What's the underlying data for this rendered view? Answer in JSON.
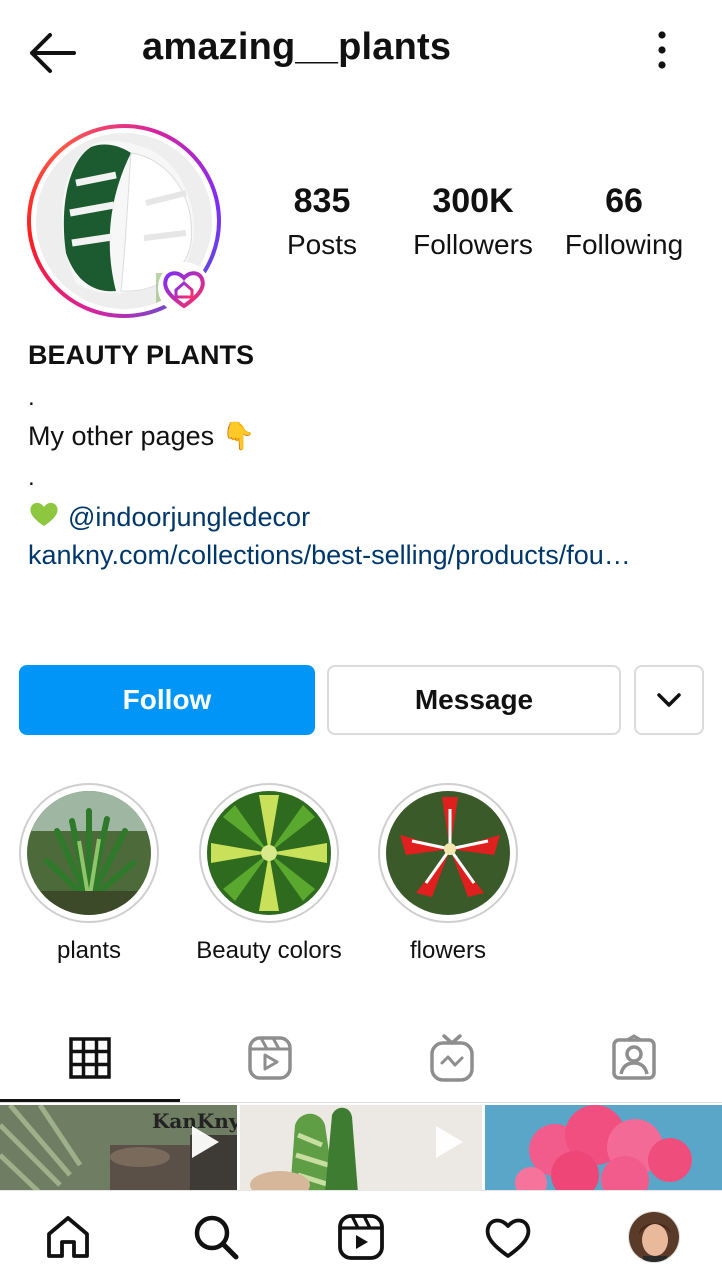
{
  "header": {
    "username": "amazing__plants"
  },
  "stats": [
    {
      "value": "835",
      "label": "Posts"
    },
    {
      "value": "300K",
      "label": "Followers"
    },
    {
      "value": "66",
      "label": "Following"
    }
  ],
  "bio": {
    "name": "BEAUTY PLANTS",
    "dot1": ".",
    "line1": "My other pages 👇",
    "dot2": ".",
    "mention": "@indoorjungledecor",
    "link": "kankny.com/collections/best-selling/products/fou…"
  },
  "actions": {
    "follow_label": "Follow",
    "message_label": "Message"
  },
  "highlights": [
    {
      "label": "plants"
    },
    {
      "label": "Beauty colors"
    },
    {
      "label": "flowers"
    }
  ],
  "grid": {
    "watermark": "KanKny"
  },
  "colors": {
    "accent_blue": "#0095f6",
    "link_blue": "#00376b",
    "border": "#dbdbdb"
  },
  "icons": {
    "back": "arrow-left-icon",
    "more": "more-vertical-icon",
    "badge": "heart-home-icon",
    "dropdown": "chevron-down-icon",
    "tab_grid": "grid-icon",
    "tab_reels": "reels-icon",
    "tab_igtv": "igtv-icon",
    "tab_tagged": "tagged-user-icon",
    "nav_home": "home-icon",
    "nav_search": "search-icon",
    "nav_reels": "reels-icon",
    "nav_activity": "heart-icon",
    "nav_profile": "profile-avatar"
  }
}
